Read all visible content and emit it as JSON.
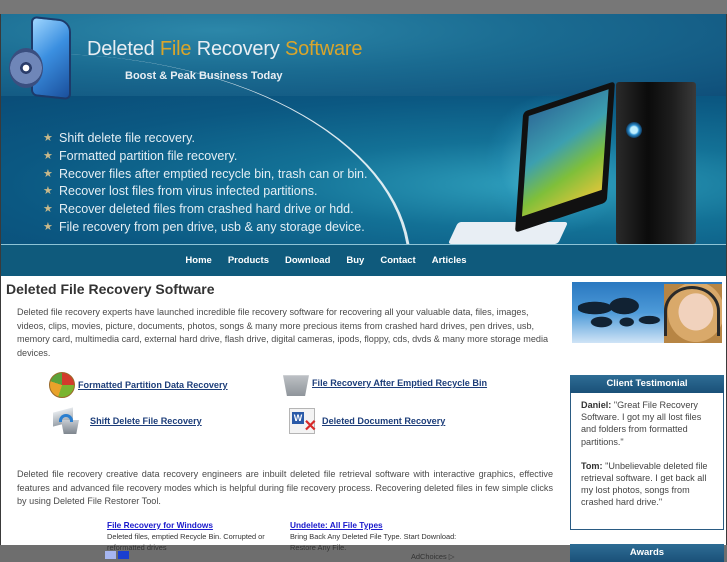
{
  "header": {
    "title_parts": [
      {
        "text": "Deleted ",
        "highlight": false
      },
      {
        "text": "File",
        "highlight": true
      },
      {
        "text": " Recovery ",
        "highlight": false
      },
      {
        "text": "Software",
        "highlight": true
      }
    ],
    "tagline": "Boost & Peak Business Today",
    "features": [
      "Shift delete file recovery.",
      "Formatted partition file recovery.",
      "Recover files after emptied recycle bin, trash can or bin.",
      "Recover lost files from virus infected partitions.",
      "Recover deleted files from crashed hard drive or hdd.",
      "File recovery from pen drive, usb & any storage device."
    ],
    "feature_icon": "star-icon",
    "colors": {
      "title_text": "#e8eef3",
      "title_highlight": "#d9a52b",
      "banner_blue": "#0f5a7c"
    }
  },
  "nav": {
    "items": [
      "Home",
      "Products",
      "Download",
      "Buy",
      "Contact",
      "Articles"
    ]
  },
  "main": {
    "title": "Deleted File Recovery Software",
    "intro": "Deleted file recovery experts have launched incredible file recovery software for recovering all your valuable data, files, images, videos, clips, movies, picture, documents, photos, songs & many more precious items from crashed hard drives, pen drives, usb, memory card, multimedia card, external hard drive, flash drive, digital cameras, ipods, floppy, cds, dvds & many more storage media devices.",
    "feature_links": [
      {
        "label": "Formatted Partition Data Recovery",
        "icon": "partition-pie-icon"
      },
      {
        "label": "File Recovery After Emptied Recycle Bin",
        "icon": "recycle-bin-icon"
      },
      {
        "label": "Shift Delete File Recovery",
        "icon": "shift-delete-icon"
      },
      {
        "label": "Deleted Document Recovery",
        "icon": "word-document-icon"
      }
    ],
    "body": "Deleted file recovery creative data recovery engineers are inbuilt deleted file retrieval software with interactive graphics, effective features and advanced file recovery modes which is helpful during file recovery process. Recovering deleted files in few simple clicks by using Deleted File Restorer Tool.",
    "ads": [
      {
        "title": "File Recovery for Windows",
        "desc": "Deleted files, emptied Recycle Bin. Corrupted or reformatted drives"
      },
      {
        "title": "Undelete: All File Types",
        "desc": "Bring Back Any Deleted File Type. Start Download: Restore Any File."
      }
    ],
    "adchoices": "AdChoices ▷"
  },
  "sidebar": {
    "testimonial_heading": "Client Testimonial",
    "testimonials": [
      {
        "name": "Daniel:",
        "quote": "\"Great File Recovery Software. I got my all lost files and folders from formatted partitions.\""
      },
      {
        "name": "Tom:",
        "quote": "\"Unbelievable deleted file retrieval software. I get back all my lost photos, songs from crashed hard drive.\""
      }
    ],
    "awards_heading": "Awards"
  }
}
